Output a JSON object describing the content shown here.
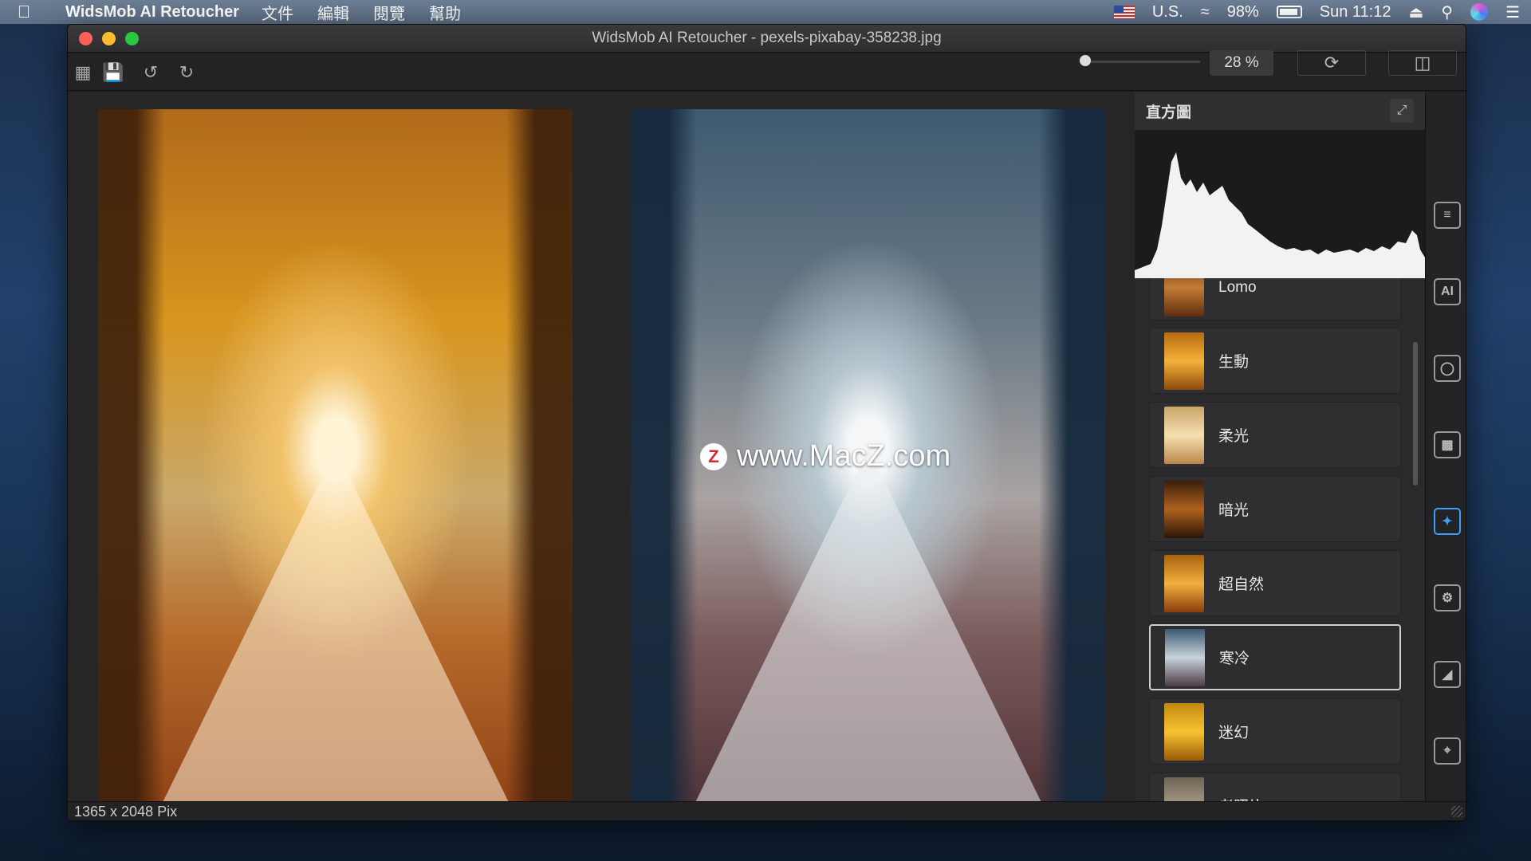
{
  "menubar": {
    "app_name": "WidsMob AI Retoucher",
    "menus": [
      "文件",
      "編輯",
      "閱覽",
      "幫助"
    ],
    "input_source": "U.S.",
    "battery": "98%",
    "clock": "Sun 11:12"
  },
  "window": {
    "title": "WidsMob AI Retoucher - pexels-pixabay-358238.jpg"
  },
  "toolbar": {
    "zoom": "28 %",
    "zoom_slider_fraction": 0.0
  },
  "watermark": {
    "logo": "Z",
    "text": "www.MacZ.com"
  },
  "panel": {
    "title": "直方圖",
    "filters": [
      {
        "label": "Lomo",
        "tone": "warm"
      },
      {
        "label": "生動",
        "tone": "warm"
      },
      {
        "label": "柔光",
        "tone": "soft"
      },
      {
        "label": "暗光",
        "tone": "dark"
      },
      {
        "label": "超自然",
        "tone": "warm"
      },
      {
        "label": "寒冷",
        "tone": "cold",
        "selected": true
      },
      {
        "label": "迷幻",
        "tone": "warm"
      },
      {
        "label": "老照片",
        "tone": "old"
      }
    ]
  },
  "status": {
    "dimensions": "1365 x 2048 Pix"
  },
  "icons": {
    "grid": "grid-icon",
    "save": "save-icon",
    "rotate_left": "rotate-left-icon",
    "rotate_right": "rotate-right-icon",
    "refresh": "refresh-icon",
    "compare": "compare-view-icon",
    "expand": "expand-icon",
    "rail": [
      "adjustments-icon",
      "ai-icon",
      "portrait-icon",
      "noise-icon",
      "magic-wand-icon",
      "settings-icon",
      "effects-icon",
      "crop-icon"
    ]
  },
  "colors": {
    "selected_border": "#cfcfcf",
    "active_rail": "#3aa0ff"
  }
}
